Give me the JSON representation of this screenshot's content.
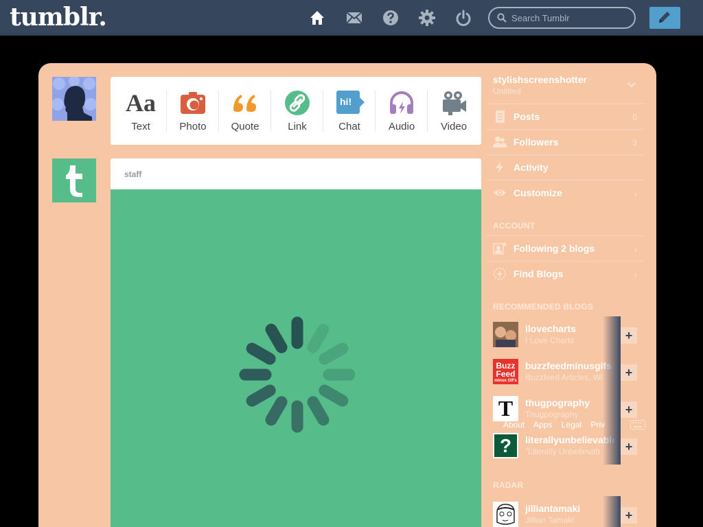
{
  "brand": {
    "logo": "tumblr."
  },
  "nav": {
    "icons": [
      "home-icon",
      "mail-icon",
      "help-icon",
      "gear-icon",
      "power-icon"
    ],
    "search_placeholder": "Search Tumblr"
  },
  "post_types": [
    {
      "label": "Text",
      "icon": "text-icon",
      "color": "#444444"
    },
    {
      "label": "Photo",
      "icon": "camera-icon",
      "color": "#d95e40"
    },
    {
      "label": "Quote",
      "icon": "quote-icon",
      "color": "#f2992e"
    },
    {
      "label": "Link",
      "icon": "link-icon",
      "color": "#56bc8a"
    },
    {
      "label": "Chat",
      "icon": "chat-icon",
      "color": "#529ecc"
    },
    {
      "label": "Audio",
      "icon": "headphones-icon",
      "color": "#a77dc2"
    },
    {
      "label": "Video",
      "icon": "video-camera-icon",
      "color": "#748089"
    }
  ],
  "post": {
    "author": "staff"
  },
  "sidebar": {
    "blog_name": "stylishscreenshotter",
    "blog_title": "Untitled",
    "rows": [
      {
        "label": "Posts",
        "count": "0"
      },
      {
        "label": "Followers",
        "count": "3"
      },
      {
        "label": "Activity",
        "count": ""
      },
      {
        "label": "Customize",
        "count": "›"
      }
    ],
    "account_heading": "ACCOUNT",
    "account_rows": [
      {
        "label": "Following 2 blogs"
      },
      {
        "label": "Find Blogs"
      }
    ],
    "recommended_heading": "RECOMMENDED BLOGS",
    "recommended": [
      {
        "name": "ilovecharts",
        "desc": "I Love Charts"
      },
      {
        "name": "buzzfeedminusgifs",
        "desc": "Buzzfeed Articles, Wi"
      },
      {
        "name": "thugpography",
        "desc": "Thugpography"
      },
      {
        "name": "literallyunbelievable",
        "desc": "\"Literally Unbelievab"
      }
    ],
    "radar_heading": "RADAR",
    "radar": [
      {
        "name": "jilliantamaki",
        "desc": "Jillian Tamaki"
      }
    ],
    "footer_links": [
      "About",
      "Apps",
      "Legal",
      "Priv"
    ],
    "follow_glyph": "+",
    "chevron": "›",
    "avatar_text": {
      "buzz1": "Buzz",
      "buzz2": "Feed",
      "buzz3": "minus GIFs",
      "thug": "T",
      "lit": "?"
    }
  },
  "post_type_glyphs": {
    "text": "Aa",
    "chat": "hi!"
  },
  "colors": {
    "topbar": "#36465d",
    "panel": "#f7c6a5",
    "accent": "#529ecc",
    "green": "#56bc8a"
  }
}
